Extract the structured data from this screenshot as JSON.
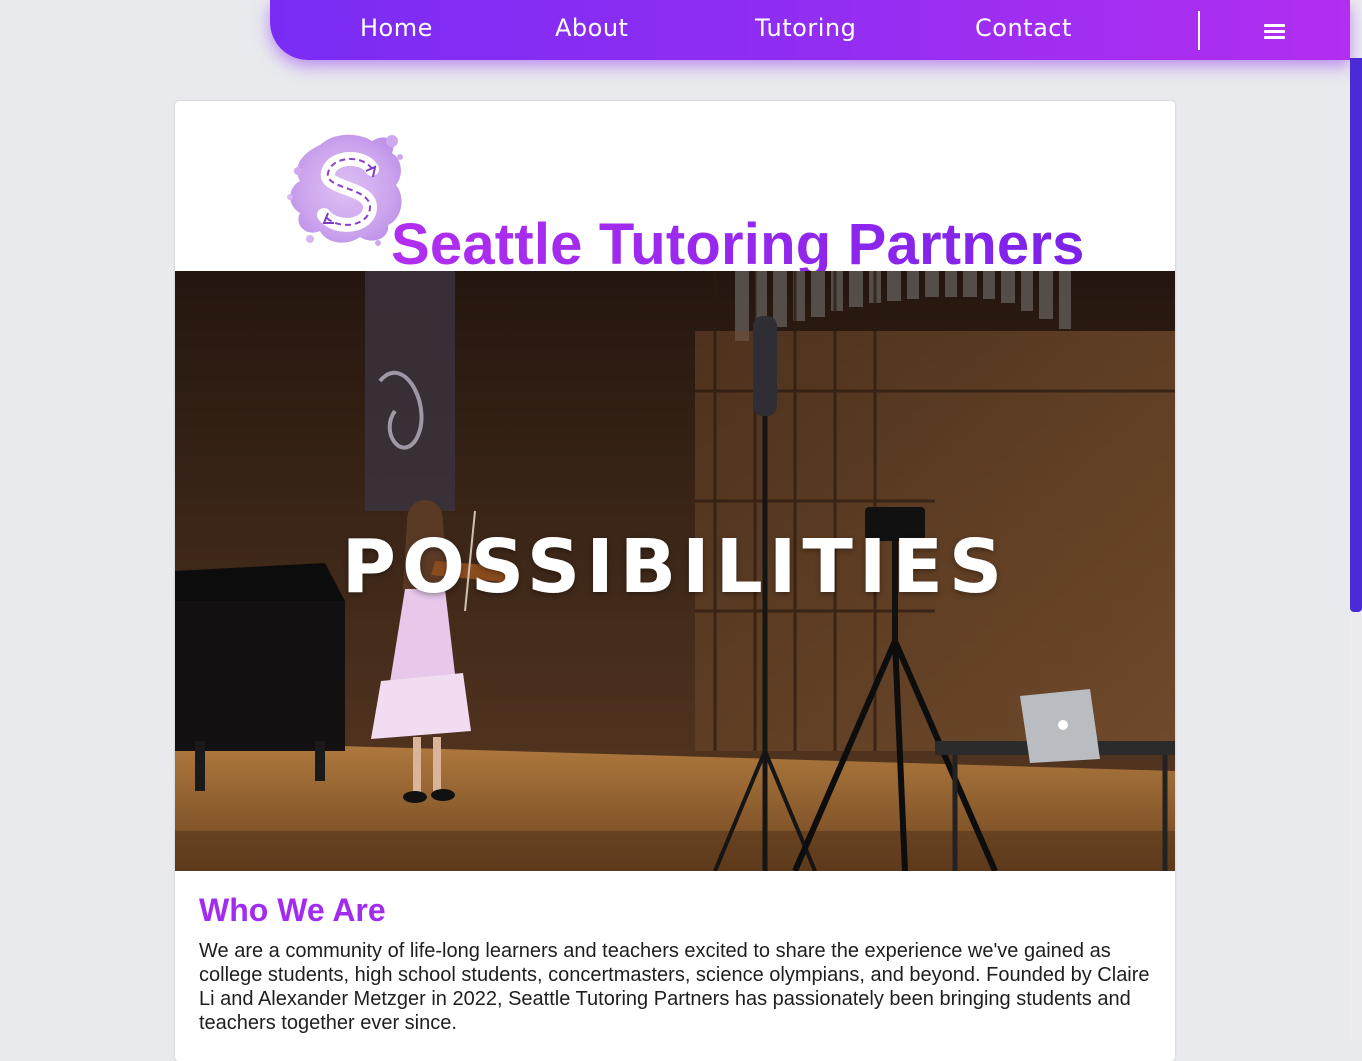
{
  "nav": {
    "items": [
      {
        "label": "Home"
      },
      {
        "label": "About"
      },
      {
        "label": "Tutoring"
      },
      {
        "label": "Contact"
      }
    ],
    "menu_icon": "hamburger-menu-icon"
  },
  "header": {
    "title": "Seattle Tutoring Partners",
    "logo_icon": "purple-splash-s-logo"
  },
  "hero": {
    "overlay_text": "POSSIBILITIES",
    "image_description_icon": "violin-recital-photo"
  },
  "about": {
    "heading": "Who We Are",
    "body": "We are a community of life-long learners and teachers excited to share the experience we've gained as college students, high school students, concertmasters, science olympians, and beyond. Founded by Claire Li and Alexander Metzger in 2022, Seattle Tutoring Partners has passionately been bringing students and teachers together ever since."
  },
  "colors": {
    "nav_gradient_start": "#7a2cf5",
    "nav_gradient_end": "#b22ef0",
    "title_purple": "#9b2cf2",
    "heading_purple": "#a12cf0",
    "page_background": "#e9eaee",
    "scrollbar_thumb": "#4b2bd6"
  }
}
